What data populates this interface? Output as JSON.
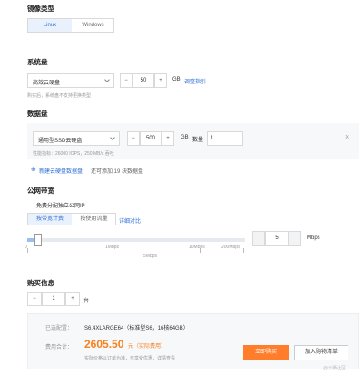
{
  "image_type": {
    "heading": "镜像类型",
    "tabs": [
      {
        "label": "Linux",
        "active": true
      },
      {
        "label": "Windows",
        "active": false
      }
    ]
  },
  "system_disk": {
    "heading": "系统盘",
    "type_value": "高效云硬盘",
    "size": "50",
    "unit": "GB",
    "link": "调整指引",
    "hint": "购买后，系统盘不支持更换类型"
  },
  "data_disk": {
    "heading": "数据盘",
    "type_value": "通用型SSD云硬盘",
    "size": "500",
    "unit": "GB",
    "qty_label": "数量",
    "qty": "1",
    "perf": "性能指标：26000 IOPS，250 MB/s 吞吐",
    "add_link": "新建云硬盘数据盘",
    "add_note": "还可添加 19 块数据盘"
  },
  "bandwidth": {
    "heading": "公网带宽",
    "public_ip_label": "免费分配独立公网IP",
    "tabs": [
      {
        "label": "按带宽计费",
        "active": true
      },
      {
        "label": "按使用流量",
        "active": false
      }
    ],
    "link": "详细对比",
    "slider_labels": [
      "0",
      "1Mbps",
      "5Mbps",
      "10Mbps",
      "200Mbps"
    ],
    "value": "5",
    "value_fraction": 0.05,
    "unit": "Mbps"
  },
  "purchase": {
    "heading": "购买信息",
    "qty": "1",
    "qty_unit": "台",
    "config_label": "已选配置：",
    "config_value": "S6.4XLARGE64（标准型S6，16核64GB）",
    "cost_label": "费用合计：",
    "price": "2605.50",
    "price_unit": "元（实际费用）",
    "price_note": "实际价格以订单为准，可享受优惠，详情查看",
    "buy_button": "立即购买",
    "cart_button": "加入购物清单",
    "watermark": "@云栖社区"
  },
  "colors": {
    "accent": "#2f6fd6",
    "price": "#f5811f",
    "buy": "#ff7d2b"
  }
}
